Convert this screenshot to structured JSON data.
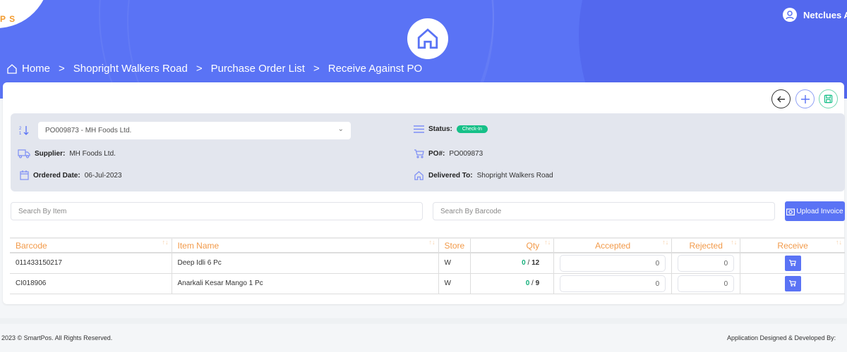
{
  "header": {
    "logo": "P S",
    "user": "Netclues A"
  },
  "breadcrumb": [
    "Home",
    "Shopright Walkers Road",
    "Purchase Order List",
    "Receive Against PO"
  ],
  "po_select": "PO009873 - MH Foods Ltd.",
  "info": {
    "supplier_label": "Supplier:",
    "supplier": "MH Foods Ltd.",
    "ordered_label": "Ordered Date:",
    "ordered": "06-Jul-2023",
    "status_label": "Status:",
    "status": "Check-In",
    "po_label": "PO#:",
    "po": "PO009873",
    "delivered_label": "Delivered To:",
    "delivered": "Shopright Walkers Road"
  },
  "search": {
    "item_placeholder": "Search By Item",
    "barcode_placeholder": "Search By Barcode",
    "upload": "Upload Invoice"
  },
  "table": {
    "headers": [
      "Barcode",
      "Item Name",
      "Store",
      "Qty",
      "Accepted",
      "Rejected",
      "Receive"
    ],
    "rows": [
      {
        "barcode": "011433150217",
        "name": "Deep Idli 6 Pc",
        "store": "W",
        "received": "0",
        "qty": "12",
        "accepted": "0",
        "rejected": "0"
      },
      {
        "barcode": "CI018906",
        "name": "Anarkali Kesar Mango 1 Pc",
        "store": "W",
        "received": "0",
        "qty": "9",
        "accepted": "0",
        "rejected": "0"
      }
    ]
  },
  "footer": {
    "left": "2023 © SmartPos. All Rights Reserved.",
    "right": "Application Designed & Developed By:"
  },
  "colors": {
    "primary": "#5a73f5",
    "accent": "#f29a4a",
    "success": "#16c088"
  }
}
